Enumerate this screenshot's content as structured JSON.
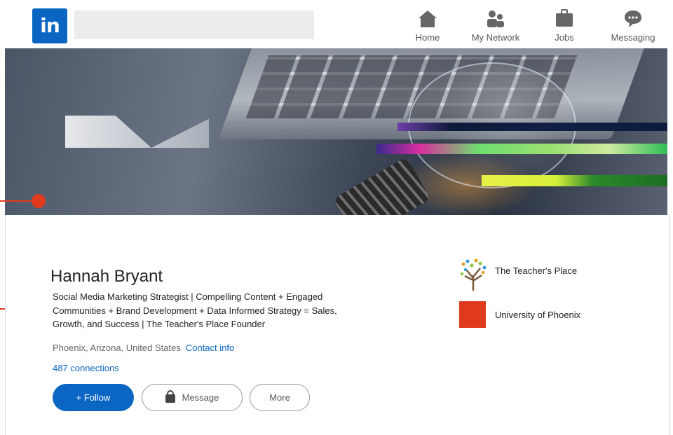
{
  "nav": {
    "logo_text": "in",
    "search_placeholder": "",
    "items": [
      {
        "label": "Home",
        "icon": "home-icon"
      },
      {
        "label": "My Network",
        "icon": "network-icon"
      },
      {
        "label": "Jobs",
        "icon": "briefcase-icon"
      },
      {
        "label": "Messaging",
        "icon": "chat-icon"
      }
    ]
  },
  "profile": {
    "name": "Hannah Bryant",
    "headline": "Social Media Marketing Strategist | Compelling Content + Engaged Communities + Brand Development + Data Informed Strategy = Sales, Growth, and Success | The Teacher's Place Founder",
    "location": "Phoenix, Arizona, United States",
    "contact_label": "Contact info",
    "connections": "487 connections"
  },
  "actions": {
    "follow": "+ Follow",
    "message": "Message",
    "more": "More"
  },
  "organizations": [
    {
      "name": "The Teacher's Place",
      "logo": "tree-logo"
    },
    {
      "name": "University of Phoenix",
      "logo": "red-square-logo"
    }
  ],
  "colors": {
    "brand": "#0a66c2",
    "annotation": "#e03a1e",
    "org_red": "#e03a1e"
  }
}
